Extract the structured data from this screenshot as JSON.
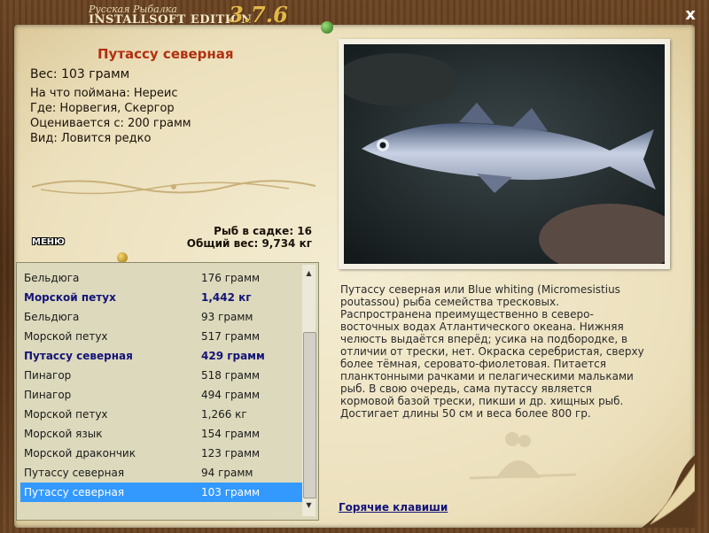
{
  "window": {
    "brand_top": "Русская Рыбалка",
    "brand_bottom": "INSTALLSOFT EDITION",
    "version": "3.7.6",
    "close_glyph": "x"
  },
  "fish": {
    "title": "Путассу северная",
    "weight": "Вес: 103 грамм",
    "caught_on": "На что поймана: Нереис",
    "where": "Где: Норвегия, Скергор",
    "valued": "Оценивается с: 200 грамм",
    "kind": "Вид: Ловится редко"
  },
  "basket": {
    "count": "Рыб в садке: 16",
    "total_weight": "Общий вес: 9,734 кг"
  },
  "menu_label": "МЕНЮ",
  "catch_list": [
    {
      "name": "Бельдюга",
      "weight": "176 грамм",
      "style": ""
    },
    {
      "name": "Морской петух",
      "weight": "1,442 кг",
      "style": "bold"
    },
    {
      "name": "Бельдюга",
      "weight": "93 грамм",
      "style": ""
    },
    {
      "name": "Морской петух",
      "weight": "517 грамм",
      "style": ""
    },
    {
      "name": "Путассу северная",
      "weight": "429 грамм",
      "style": "bold"
    },
    {
      "name": "Пинагор",
      "weight": "518 грамм",
      "style": ""
    },
    {
      "name": "Пинагор",
      "weight": "494 грамм",
      "style": ""
    },
    {
      "name": "Морской петух",
      "weight": "1,266 кг",
      "style": ""
    },
    {
      "name": "Морской язык",
      "weight": "154 грамм",
      "style": ""
    },
    {
      "name": "Морской дракончик",
      "weight": "123 грамм",
      "style": ""
    },
    {
      "name": "Путассу северная",
      "weight": "94 грамм",
      "style": ""
    },
    {
      "name": "Путассу северная",
      "weight": "103 грамм",
      "style": "sel"
    }
  ],
  "description": "Путассу северная или Blue whiting (Micromesistius poutassou) рыба семейства тресковых. Распространена преимущественно в северо-восточных водах Атлантического океана. Нижняя челюсть выдаётся вперёд; усика на подбородке, в отличии от трески, нет. Окраска серебристая, сверху более тёмная, серовато-фиолетовая. Питается планктонными рачками и пелагическими мальками рыб. В свою очередь, сама путассу является кормовой базой трески, пикши и др. хищных рыб. Достигает длины 50 см и веса более 800 гр.",
  "hotkeys_link": "Горячие клавиши",
  "colors": {
    "title_red": "#b03010",
    "highlight_blue": "#13137a",
    "selection": "#3399ff"
  }
}
